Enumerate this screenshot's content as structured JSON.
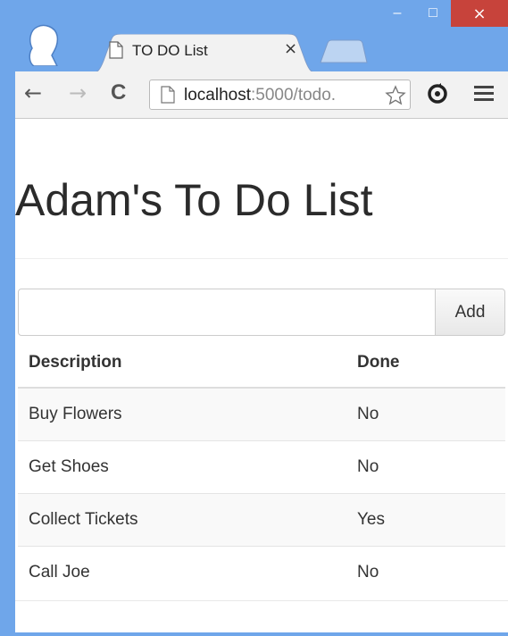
{
  "browser": {
    "tab_title": "TO DO List",
    "tab_close": "×",
    "url_host": "localhost",
    "url_rest": ":5000/todo.",
    "minimize": "–",
    "maximize": "□",
    "close": "×",
    "back": "←",
    "forward": "→",
    "reload": "C"
  },
  "page": {
    "title": "Adam's To Do List",
    "input_value": "",
    "add_label": "Add",
    "columns": [
      "Description",
      "Done"
    ],
    "rows": [
      {
        "description": "Buy Flowers",
        "done": "No"
      },
      {
        "description": "Get Shoes",
        "done": "No"
      },
      {
        "description": "Collect Tickets",
        "done": "Yes"
      },
      {
        "description": "Call Joe",
        "done": "No"
      }
    ]
  },
  "colors": {
    "frame": "#6fa6ea",
    "close_button": "#c7433b",
    "toolbar": "#f2f2f2"
  }
}
